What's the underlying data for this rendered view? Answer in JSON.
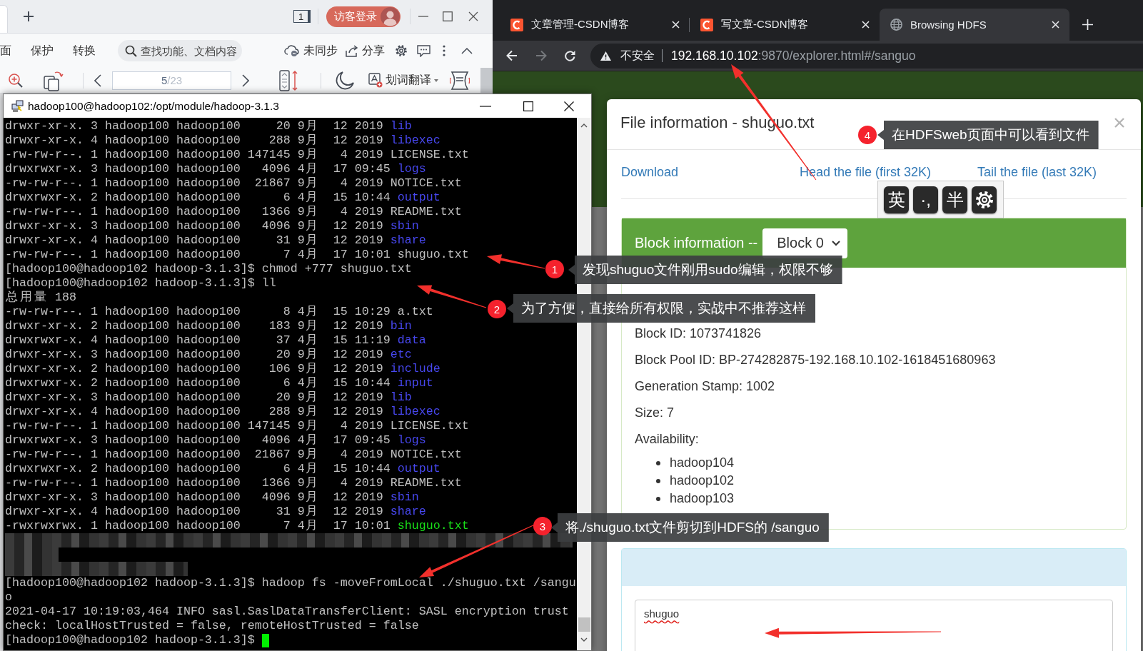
{
  "wps": {
    "count_badge": "1",
    "login": "访客登录",
    "menu": [
      "面",
      "保护",
      "转换"
    ],
    "search": {
      "placeholder": "查找功能、文档内容"
    },
    "sync": "未同步",
    "share": "分享",
    "page": {
      "current": "5",
      "total": "/23"
    },
    "translate": "划词翻译"
  },
  "browser": {
    "tabs": [
      {
        "title": "文章管理-CSDN博客",
        "kind": "logo",
        "selected": false
      },
      {
        "title": "写文章-CSDN博客",
        "kind": "logo",
        "selected": false
      },
      {
        "title": "Browsing HDFS",
        "kind": "globe",
        "selected": true
      }
    ],
    "address": {
      "security": "不安全",
      "host": "192.168.10.102",
      "path": ":9870/explorer.html#/sanguo"
    }
  },
  "terminal": {
    "title": "hadoop100@hadoop102:/opt/module/hadoop-3.1.3",
    "lines": [
      {
        "kind": "entry",
        "details": "drwxr-xr-x. 3 hadoop100 hadoop100     20 9月  12 2019",
        "name": "lib",
        "color": "#4747ee"
      },
      {
        "kind": "entry",
        "details": "drwxr-xr-x. 4 hadoop100 hadoop100    288 9月  12 2019",
        "name": "libexec",
        "color": "#4747ee"
      },
      {
        "kind": "entry",
        "details": "-rw-rw-r--. 1 hadoop100 hadoop100 147145 9月   4 2019",
        "name": "LICENSE.txt",
        "color": "#c0c0c0"
      },
      {
        "kind": "entry",
        "details": "drwxrwxr-x. 3 hadoop100 hadoop100   4096 4月  17 09:45",
        "name": "logs",
        "color": "#4747ee"
      },
      {
        "kind": "entry",
        "details": "-rw-rw-r--. 1 hadoop100 hadoop100  21867 9月   4 2019",
        "name": "NOTICE.txt",
        "color": "#c0c0c0"
      },
      {
        "kind": "entry",
        "details": "drwxrwxr-x. 2 hadoop100 hadoop100      6 4月  15 10:44",
        "name": "output",
        "color": "#4747ee"
      },
      {
        "kind": "entry",
        "details": "-rw-rw-r--. 1 hadoop100 hadoop100   1366 9月   4 2019",
        "name": "README.txt",
        "color": "#c0c0c0"
      },
      {
        "kind": "entry",
        "details": "drwxr-xr-x. 3 hadoop100 hadoop100   4096 9月  12 2019",
        "name": "sbin",
        "color": "#4747ee"
      },
      {
        "kind": "entry",
        "details": "drwxr-xr-x. 4 hadoop100 hadoop100     31 9月  12 2019",
        "name": "share",
        "color": "#4747ee"
      },
      {
        "kind": "entry",
        "details": "-rw-rw-r--. 1 hadoop100 hadoop100      7 4月  17 10:01",
        "name": "shuguo.txt",
        "color": "#c0c0c0"
      },
      {
        "kind": "text",
        "text": "[hadoop100@hadoop102 hadoop-3.1.3]$ chmod +777 shuguo.txt"
      },
      {
        "kind": "text",
        "text": "[hadoop100@hadoop102 hadoop-3.1.3]$ ll"
      },
      {
        "kind": "text",
        "text": "总用量 188"
      },
      {
        "kind": "entry",
        "details": "-rw-rw-r--. 1 hadoop100 hadoop100      8 4月  15 10:29",
        "name": "a.txt",
        "color": "#c0c0c0"
      },
      {
        "kind": "entry",
        "details": "drwxr-xr-x. 2 hadoop100 hadoop100    183 9月  12 2019",
        "name": "bin",
        "color": "#4747ee"
      },
      {
        "kind": "entry",
        "details": "drwxrwxr-x. 4 hadoop100 hadoop100     37 4月  15 11:19",
        "name": "data",
        "color": "#4747ee"
      },
      {
        "kind": "entry",
        "details": "drwxr-xr-x. 3 hadoop100 hadoop100     20 9月  12 2019",
        "name": "etc",
        "color": "#4747ee"
      },
      {
        "kind": "entry",
        "details": "drwxr-xr-x. 2 hadoop100 hadoop100    106 9月  12 2019",
        "name": "include",
        "color": "#4747ee"
      },
      {
        "kind": "entry",
        "details": "drwxrwxr-x. 2 hadoop100 hadoop100      6 4月  15 10:44",
        "name": "input",
        "color": "#4747ee"
      },
      {
        "kind": "entry",
        "details": "drwxr-xr-x. 3 hadoop100 hadoop100     20 9月  12 2019",
        "name": "lib",
        "color": "#4747ee"
      },
      {
        "kind": "entry",
        "details": "drwxr-xr-x. 4 hadoop100 hadoop100    288 9月  12 2019",
        "name": "libexec",
        "color": "#4747ee"
      },
      {
        "kind": "entry",
        "details": "-rw-rw-r--. 1 hadoop100 hadoop100 147145 9月   4 2019",
        "name": "LICENSE.txt",
        "color": "#c0c0c0"
      },
      {
        "kind": "entry",
        "details": "drwxrwxr-x. 3 hadoop100 hadoop100   4096 4月  17 09:45",
        "name": "logs",
        "color": "#4747ee"
      },
      {
        "kind": "entry",
        "details": "-rw-rw-r--. 1 hadoop100 hadoop100  21867 9月   4 2019",
        "name": "NOTICE.txt",
        "color": "#c0c0c0"
      },
      {
        "kind": "entry",
        "details": "drwxrwxr-x. 2 hadoop100 hadoop100      6 4月  15 10:44",
        "name": "output",
        "color": "#4747ee"
      },
      {
        "kind": "entry",
        "details": "-rw-rw-r--. 1 hadoop100 hadoop100   1366 9月   4 2019",
        "name": "README.txt",
        "color": "#c0c0c0"
      },
      {
        "kind": "entry",
        "details": "drwxr-xr-x. 3 hadoop100 hadoop100   4096 9月  12 2019",
        "name": "sbin",
        "color": "#4747ee"
      },
      {
        "kind": "entry",
        "details": "drwxr-xr-x. 4 hadoop100 hadoop100     31 9月  12 2019",
        "name": "share",
        "color": "#4747ee"
      },
      {
        "kind": "entry",
        "details": "-rwxrwxrwx. 1 hadoop100 hadoop100      7 4月  17 10:01",
        "name": "shuguo.txt",
        "color": "#19e019"
      },
      {
        "kind": "redacted"
      },
      {
        "kind": "redacted"
      },
      {
        "kind": "redacted"
      },
      {
        "kind": "text",
        "text": "[hadoop100@hadoop102 hadoop-3.1.3]$ hadoop fs -moveFromLocal ./shuguo.txt /sangu"
      },
      {
        "kind": "text",
        "text": "o"
      },
      {
        "kind": "text",
        "text": "2021-04-17 10:19:03,464 INFO sasl.SaslDataTransferClient: SASL encryption trust"
      },
      {
        "kind": "text",
        "text": "check: localHostTrusted = false, remoteHostTrusted = false"
      },
      {
        "kind": "prompt",
        "text": "[hadoop100@hadoop102 hadoop-3.1.3]$"
      }
    ]
  },
  "dialog": {
    "title": "File information - shuguo.txt",
    "links": [
      "Download",
      "Head the file (first 32K)",
      "Tail the file (last 32K)"
    ],
    "block_panel": {
      "title": "Block information --",
      "select": "Block 0",
      "fields": [
        "Block ID: 1073741826",
        "Block Pool ID: BP-274282875-192.168.10.102-1618451680963",
        "Generation Stamp: 1002",
        "Size: 7"
      ],
      "availability": "Availability:",
      "hosts": [
        "hadoop104",
        "hadoop102",
        "hadoop103"
      ]
    },
    "contents": "shuguo"
  },
  "ime": {
    "keys": [
      {
        "kind": "text",
        "label": "英"
      },
      {
        "kind": "text",
        "label": "·,"
      },
      {
        "kind": "text",
        "label": "半"
      },
      {
        "kind": "settings"
      }
    ]
  },
  "annotations": [
    {
      "number": "1",
      "text": "发现shuguo文件刚用sudo编辑，权限不够"
    },
    {
      "number": "2",
      "text": "为了方便，直接给所有权限，实战中不推荐这样"
    },
    {
      "number": "3",
      "text": "将./shuguo.txt文件剪切到HDFS的 /sanguo"
    },
    {
      "number": "4",
      "text": "在HDFSweb页面中可以看到文件"
    }
  ]
}
